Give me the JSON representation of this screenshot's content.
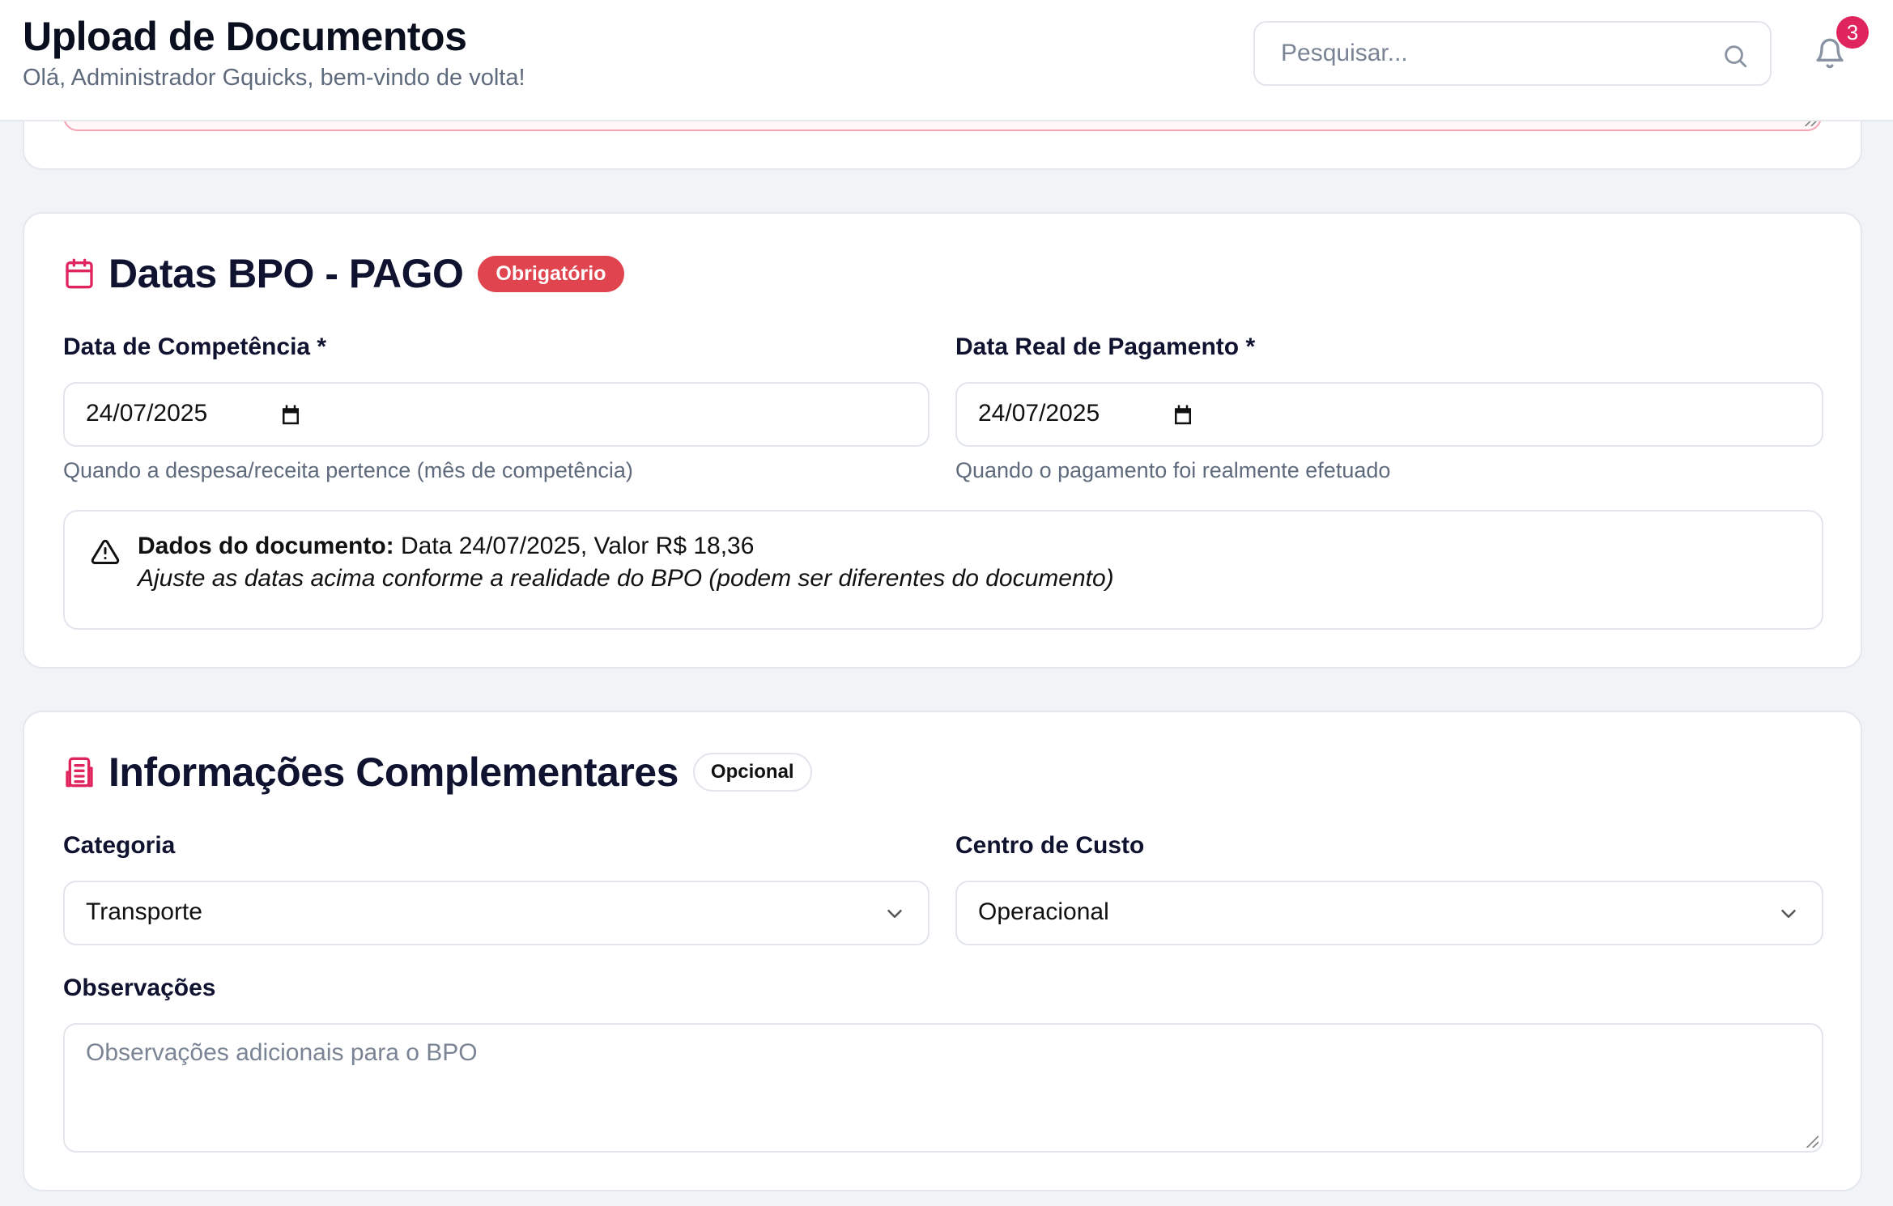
{
  "header": {
    "title": "Upload de Documentos",
    "subtitle": "Olá, Administrador Gquicks, bem-vindo de volta!",
    "search_placeholder": "Pesquisar...",
    "notification_count": "3"
  },
  "dates_section": {
    "title": "Datas BPO - PAGO",
    "badge": "Obrigatório",
    "competencia": {
      "label": "Data de Competência *",
      "value": "24/07/2025",
      "hint": "Quando a despesa/receita pertence (mês de competência)"
    },
    "pagamento": {
      "label": "Data Real de Pagamento *",
      "value": "24/07/2025",
      "hint": "Quando o pagamento foi realmente efetuado"
    },
    "notice": {
      "bold": "Dados do documento:",
      "text": " Data 24/07/2025, Valor R$ 18,36",
      "italic": "Ajuste as datas acima conforme a realidade do BPO (podem ser diferentes do documento)"
    }
  },
  "info_section": {
    "title": "Informações Complementares",
    "badge": "Opcional",
    "categoria": {
      "label": "Categoria",
      "value": "Transporte"
    },
    "centro_custo": {
      "label": "Centro de Custo",
      "value": "Operacional"
    },
    "observacoes": {
      "label": "Observações",
      "placeholder": "Observações adicionais para o BPO"
    }
  },
  "colors": {
    "accent": "#e0245e",
    "required_badge": "#e0444f",
    "background": "#f1f4f7"
  }
}
